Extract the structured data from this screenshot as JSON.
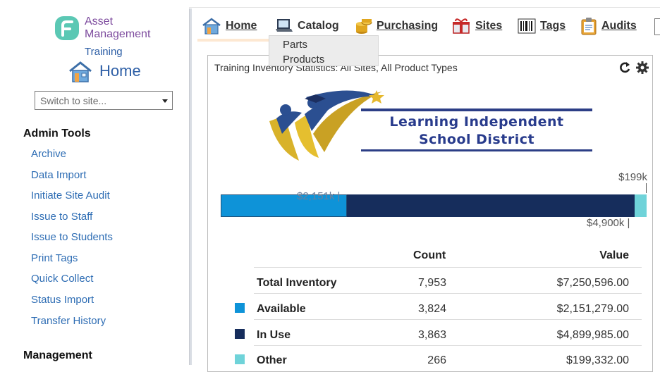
{
  "app": {
    "logo_line1": "Asset",
    "logo_line2": "Management",
    "site_name": "Training",
    "page_title": "Home"
  },
  "site_switcher": {
    "placeholder": "Switch to site..."
  },
  "sidebar": {
    "admin_tools_heading": "Admin Tools",
    "admin_tools": [
      "Archive",
      "Data Import",
      "Initiate Site Audit",
      "Issue to Staff",
      "Issue to Students",
      "Print Tags",
      "Quick Collect",
      "Status Import",
      "Transfer History"
    ],
    "management_heading": "Management"
  },
  "nav": {
    "items": [
      {
        "label": "Home",
        "icon": "home-icon"
      },
      {
        "label": "Catalog",
        "icon": "laptop-icon"
      },
      {
        "label": "Purchasing",
        "icon": "coins-icon"
      },
      {
        "label": "Sites",
        "icon": "gift-box-icon"
      },
      {
        "label": "Tags",
        "icon": "barcode-icon"
      },
      {
        "label": "Audits",
        "icon": "clipboard-icon"
      }
    ],
    "catalog_dropdown": [
      "Parts",
      "Products"
    ]
  },
  "panel": {
    "title": "Training Inventory Statistics: All Sites, All Product Types",
    "district_line1": "Learning Independent",
    "district_line2": "School District"
  },
  "chart_data": {
    "type": "bar",
    "stacked": true,
    "orientation": "horizontal",
    "series": [
      {
        "name": "Available",
        "value": 2151279,
        "label": "$2,151k",
        "color": "#0e93d8"
      },
      {
        "name": "In Use",
        "value": 4899985,
        "label": "$4,900k",
        "color": "#162d5c"
      },
      {
        "name": "Other",
        "value": 199332,
        "label": "$199k",
        "color": "#6fd3d9"
      }
    ]
  },
  "table": {
    "headers": {
      "count": "Count",
      "value": "Value"
    },
    "rows": [
      {
        "label": "Total Inventory",
        "count": "7,953",
        "value": "$7,250,596.00",
        "swatch": ""
      },
      {
        "label": "Available",
        "count": "3,824",
        "value": "$2,151,279.00",
        "swatch": "#0e93d8"
      },
      {
        "label": "In Use",
        "count": "3,863",
        "value": "$4,899,985.00",
        "swatch": "#162d5c"
      },
      {
        "label": "Other",
        "count": "266",
        "value": "$199,332.00",
        "swatch": "#6fd3d9"
      }
    ]
  }
}
